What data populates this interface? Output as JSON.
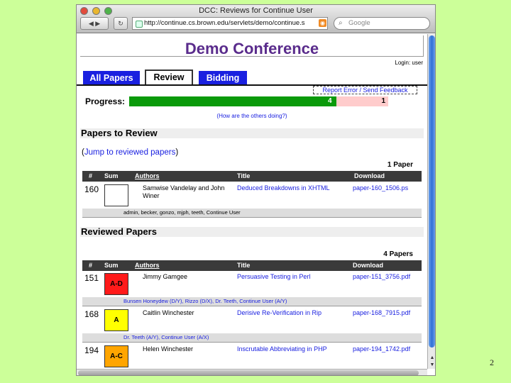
{
  "slide_number": "2",
  "window": {
    "title": "DCC: Reviews for Continue User",
    "url": "http://continue.cs.brown.edu/servlets/demo/continue.s",
    "search_placeholder": "Google",
    "back_forward_label": "◀ ▶",
    "reload_label": "↻"
  },
  "page": {
    "conference_title": "Demo Conference",
    "login": "Login: user",
    "tabs": [
      {
        "label": "All Papers",
        "active": false
      },
      {
        "label": "Review",
        "active": true
      },
      {
        "label": "Bidding",
        "active": false
      }
    ],
    "report_link": "Report Error / Send Feedback",
    "progress": {
      "label": "Progress:",
      "done": 4,
      "remaining": 1,
      "done_text": "4",
      "remaining_text": "1",
      "others_link": "(How are the others doing?)"
    },
    "to_review": {
      "heading": "Papers to Review",
      "jump_open": "(",
      "jump_link": "Jump to reviewed papers",
      "jump_close": ")",
      "count": "1 Paper",
      "columns": {
        "num": "#",
        "sum": "Sum",
        "authors": "Authors",
        "title": "Title",
        "download": "Download"
      },
      "rows": [
        {
          "num": "160",
          "sum": "",
          "authors": "Samwise Vandelay and John Winer",
          "title": "Deduced Breakdowns in XHTML",
          "download": "paper-160_1506.ps",
          "reviewers": "admin, becker, gonzo, mjph, teeth, Continue User"
        }
      ]
    },
    "reviewed": {
      "heading": "Reviewed Papers",
      "count": "4 Papers",
      "columns": {
        "num": "#",
        "sum": "Sum",
        "authors": "Authors",
        "title": "Title",
        "download": "Download"
      },
      "rows": [
        {
          "num": "151",
          "sum": "A-D",
          "sum_color": "#ff1a1a",
          "authors": "Jimmy Gamgee",
          "title": "Persuasive Testing in Perl",
          "download": "paper-151_3756.pdf",
          "reviewers": "Bunsen Honeydew (D/Y), Rizzo (D/X), Dr. Teeth, Continue User (A/Y)"
        },
        {
          "num": "168",
          "sum": "A",
          "sum_color": "#ffff00",
          "authors": "Caitlin Winchester",
          "title": "Derisive Re-Verification in Rip",
          "download": "paper-168_7915.pdf",
          "reviewers": "Dr. Teeth (A/Y), Continue User (A/X)"
        },
        {
          "num": "194",
          "sum": "A-C",
          "sum_color": "#ffa500",
          "authors": "Helen Winchester",
          "title": "Inscrutable Abbreviating in PHP",
          "download": "paper-194_1742.pdf",
          "reviewers": ""
        }
      ]
    }
  },
  "scrollbar": {
    "up_label": "▲",
    "down_label": "▼"
  }
}
